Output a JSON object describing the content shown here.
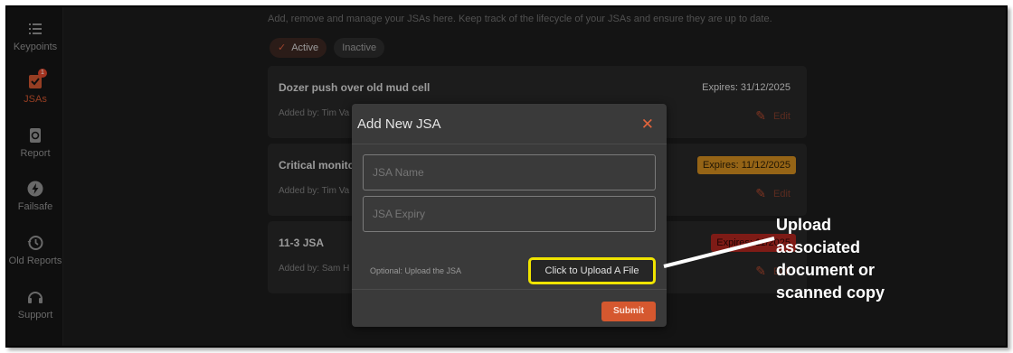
{
  "sidebar": {
    "items": [
      {
        "label": "Keypoints",
        "icon": "list-icon",
        "active": false
      },
      {
        "label": "JSAs",
        "icon": "checklist-icon",
        "active": true,
        "badge": "1"
      },
      {
        "label": "Report",
        "icon": "report-icon",
        "active": false
      },
      {
        "label": "Failsafe",
        "icon": "bolt-icon",
        "active": false
      },
      {
        "label": "Old Reports",
        "icon": "history-icon",
        "active": false
      },
      {
        "label": "Support",
        "icon": "support-icon",
        "active": false
      }
    ]
  },
  "main": {
    "subtitle": "Add, remove and manage your JSAs here. Keep track of the lifecycle of your JSAs and ensure they are up to date.",
    "tabs": [
      {
        "label": "Active",
        "selected": true
      },
      {
        "label": "Inactive",
        "selected": false
      }
    ],
    "cards": [
      {
        "title": "Dozer push over old mud cell",
        "added": "Added by: Tim Va",
        "expiry": "Expires: 31/12/2025",
        "status": "ok",
        "edit": "Edit"
      },
      {
        "title": "Critical monito",
        "added": "Added by: Tim Va",
        "expiry": "Expires: 11/12/2025",
        "status": "warning",
        "edit": "Edit"
      },
      {
        "title": "11-3 JSA",
        "added": "Added by: Sam H",
        "expiry": "Expires: 11/2025",
        "status": "expired",
        "edit": "Edit"
      }
    ]
  },
  "modal": {
    "title": "Add New JSA",
    "close_icon": "close-icon",
    "name_placeholder": "JSA Name",
    "expiry_placeholder": "JSA Expiry",
    "optional_label": "Optional: Upload the JSA",
    "upload_label": "Click to Upload A File",
    "submit_label": "Submit"
  },
  "callout": {
    "text": "Upload\nassociated\ndocument or\nscanned copy"
  },
  "colors": {
    "accent": "#d5582f",
    "warning": "#c7861e",
    "expired": "#a8251e",
    "highlight": "#f0e400"
  }
}
